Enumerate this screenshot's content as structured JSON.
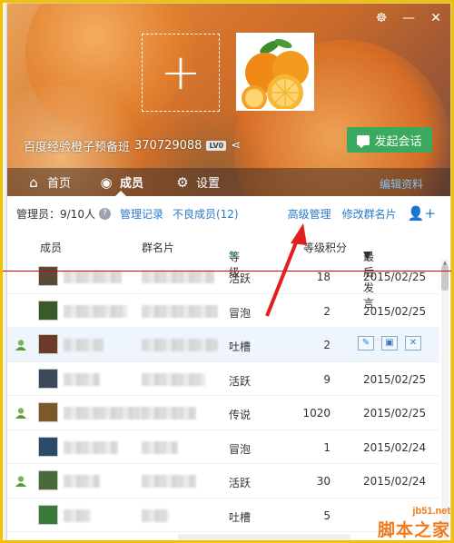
{
  "group": {
    "name": "百度经验橙子预备班",
    "id": "370729088",
    "level_badge": "LV0"
  },
  "header_actions": {
    "start_chat": "发起会话"
  },
  "tabs": [
    {
      "label": "首页"
    },
    {
      "label": "成员"
    },
    {
      "label": "设置"
    }
  ],
  "edit_profile": "编辑资料",
  "toolbar": {
    "admin_count": "管理员：9/10人",
    "manage_log": "管理记录",
    "bad_members": "不良成员(12)",
    "advanced_manage": "高级管理",
    "edit_card": "修改群名片"
  },
  "table": {
    "headers": {
      "member": "成员",
      "card": "群名片",
      "level": "等级",
      "points": "等级积分",
      "last_msg": "最后发言"
    },
    "rows": [
      {
        "level": "活跃",
        "points": "18",
        "date": "2015/02/25",
        "online": false
      },
      {
        "level": "冒泡",
        "points": "2",
        "date": "2015/02/25",
        "online": false
      },
      {
        "level": "吐槽",
        "points": "2",
        "date": "",
        "online": true,
        "actions": true
      },
      {
        "level": "活跃",
        "points": "9",
        "date": "2015/02/25",
        "online": false
      },
      {
        "level": "传说",
        "points": "1020",
        "date": "2015/02/25",
        "online": true
      },
      {
        "level": "冒泡",
        "points": "1",
        "date": "2015/02/24",
        "online": false
      },
      {
        "level": "活跃",
        "points": "30",
        "date": "2015/02/24",
        "online": true
      },
      {
        "level": "吐槽",
        "points": "5",
        "date": "",
        "online": false
      }
    ]
  },
  "watermark": {
    "url": "jb51.net",
    "name": "脚本之家"
  },
  "colors": {
    "frame": "#f2c200",
    "chat_button": "#3aaa5e",
    "link": "#2a7ac9",
    "arrow": "#e02020",
    "watermark": "#f07a1c"
  }
}
